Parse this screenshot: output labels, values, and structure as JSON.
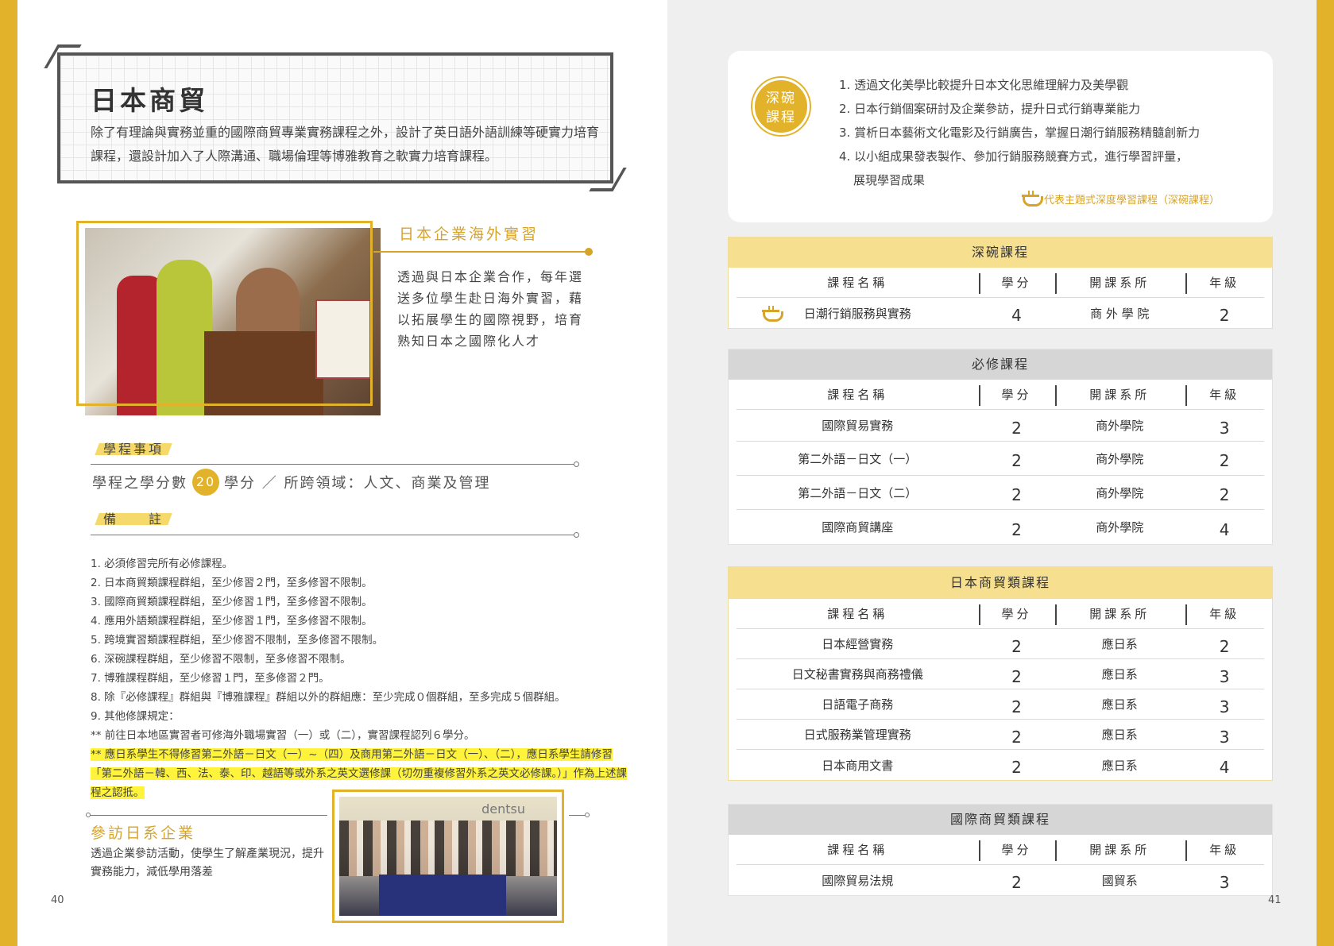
{
  "left_page": {
    "title": "日本商貿",
    "intro": "除了有理論與實務並重的國際商貿專業實務課程之外，設計了英日語外語訓練等硬實力培育課程，還設計加入了人際溝通、職場倫理等博雅教育之軟實力培育課程。",
    "internship": {
      "heading": "日本企業海外實習",
      "text": "透過與日本企業合作，每年選送多位學生赴日海外實習，藉以拓展學生的國際視野，培育熟知日本之國際化人才"
    },
    "program_tag": "學程事項",
    "credits": {
      "prefix": "學程之學分數",
      "number": "20",
      "suffix": "學分 ／ 所跨領域：人文、商業及管理"
    },
    "notes_tag": "備　　註",
    "notes": [
      "1. 必須修習完所有必修課程。",
      "2. 日本商貿類課程群組，至少修習２門，至多修習不限制。",
      "3. 國際商貿類課程群組，至少修習１門，至多修習不限制。",
      "4. 應用外語類課程群組，至少修習１門，至多修習不限制。",
      "5. 跨境實習類課程群組，至少修習不限制，至多修習不限制。",
      "6. 深碗課程群組，至少修習不限制，至多修習不限制。",
      "7. 博雅課程群組，至少修習１門，至多修習２門。",
      "8. 除『必修課程』群組與『博雅課程』群組以外的群組應：至少完成０個群組，至多完成５個群組。",
      "9. 其他修課規定：",
      "** 前往日本地區實習者可修海外職場實習（一）或（二），實習課程認列６學分。"
    ],
    "highlight_note": "** 應日系學生不得修習第二外語－日文（一）~（四）及商用第二外語－日文（一）、（二），應日系學生請修習「第二外語－韓、西、法、泰、印、越語等或外系之英文選修課（切勿重複修習外系之英文必修課。）」作為上述課程之認抵。",
    "visit": {
      "heading": "參訪日系企業",
      "text": "透過企業參訪活動，使學生了解產業現況，提升實務能力，減低學用落差"
    },
    "photo_brand": "dentsu",
    "page_number": "40"
  },
  "right_page": {
    "deep_badge_line1": "深碗",
    "deep_badge_line2": "課程",
    "deep_goals": [
      "1. 透過文化美學比較提升日本文化思維理解力及美學觀",
      "2. 日本行銷個案研討及企業參訪，提升日式行銷專業能力",
      "3. 賞析日本藝術文化電影及行銷廣告，掌握日潮行銷服務精髓創新力",
      "4. 以小組成果發表製作、參加行銷服務競賽方式，進行學習評量，"
    ],
    "deep_goal_cont": "展現學習成果",
    "deep_legend": "代表主題式深度學習課程（深碗課程）",
    "columns": {
      "name": "課程名稱",
      "credit": "學分",
      "dept": "開課系所",
      "year": "年級"
    },
    "tables": [
      {
        "title": "深碗課程",
        "rows": [
          {
            "name": "日潮行銷服務與實務",
            "credit": "4",
            "dept": "商 外 學 院",
            "year": "2"
          }
        ]
      },
      {
        "title": "必修課程",
        "rows": [
          {
            "name": "國際貿易實務",
            "credit": "2",
            "dept": "商外學院",
            "year": "3"
          },
          {
            "name": "第二外語－日文（一）",
            "credit": "2",
            "dept": "商外學院",
            "year": "2"
          },
          {
            "name": "第二外語－日文（二）",
            "credit": "2",
            "dept": "商外學院",
            "year": "2"
          },
          {
            "name": "國際商貿講座",
            "credit": "2",
            "dept": "商外學院",
            "year": "4"
          }
        ]
      },
      {
        "title": "日本商貿類課程",
        "rows": [
          {
            "name": "日本經營實務",
            "credit": "2",
            "dept": "應日系",
            "year": "2"
          },
          {
            "name": "日文秘書實務與商務禮儀",
            "credit": "2",
            "dept": "應日系",
            "year": "3"
          },
          {
            "name": "日語電子商務",
            "credit": "2",
            "dept": "應日系",
            "year": "3"
          },
          {
            "name": "日式服務業管理實務",
            "credit": "2",
            "dept": "應日系",
            "year": "3"
          },
          {
            "name": "日本商用文書",
            "credit": "2",
            "dept": "應日系",
            "year": "4"
          }
        ]
      },
      {
        "title": "國際商貿類課程",
        "rows": [
          {
            "name": "國際貿易法規",
            "credit": "2",
            "dept": "國貿系",
            "year": "3"
          }
        ]
      }
    ],
    "page_number": "41"
  },
  "colors": {
    "accent_yellow": "#e2b32a",
    "highlight": "#fff33b",
    "table_yellow": "#f6df8f",
    "table_grey": "#d6d6d6"
  }
}
